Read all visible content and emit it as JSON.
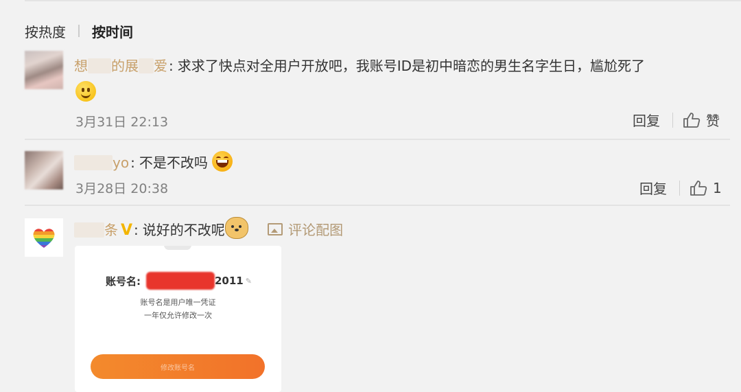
{
  "sort": {
    "hot": "按热度",
    "time": "按时间"
  },
  "comments": [
    {
      "username_fragments": [
        "想",
        "的展",
        "爱"
      ],
      "text": "求求了快点对全用户开放吧，我账号ID是初中暗恋的男生名字生日，尴尬死了",
      "emoji": "smile-emoji",
      "time": "3月31日 22:13",
      "reply": "回复",
      "like": "赞"
    },
    {
      "username_fragments": [
        "yo"
      ],
      "text": "不是不改吗",
      "emoji": "laugh-emoji",
      "time": "3月28日 20:38",
      "reply": "回复",
      "like": "1"
    },
    {
      "username_fragments": [
        "条"
      ],
      "text": "说好的不改呢",
      "emoji": "doge-emoji",
      "pic_tag": "评论配图"
    }
  ],
  "attachment": {
    "label": "账号名:",
    "suffix": "2011",
    "line1": "账号名是用户唯一凭证",
    "line2": "一年仅允许修改一次",
    "button": "修改账号名"
  },
  "colors": {
    "username": "#c8a06a",
    "verified": "#f3b500",
    "button": "#f2722a",
    "redaction": "#e8352c"
  }
}
